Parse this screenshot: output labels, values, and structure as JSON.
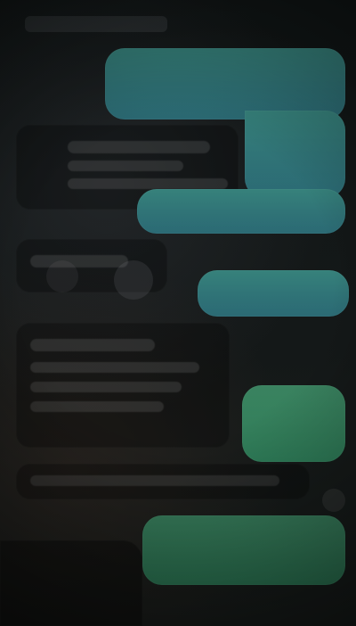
{
  "screen": {
    "background_colors": {
      "base": "#0f1414",
      "teal_bubble": "#2a6f73",
      "green_bubble": "#2f7d58"
    }
  },
  "icons": [
    {
      "name": "profile-icon"
    },
    {
      "name": "message-icon"
    },
    {
      "name": "indicator-icon"
    }
  ]
}
